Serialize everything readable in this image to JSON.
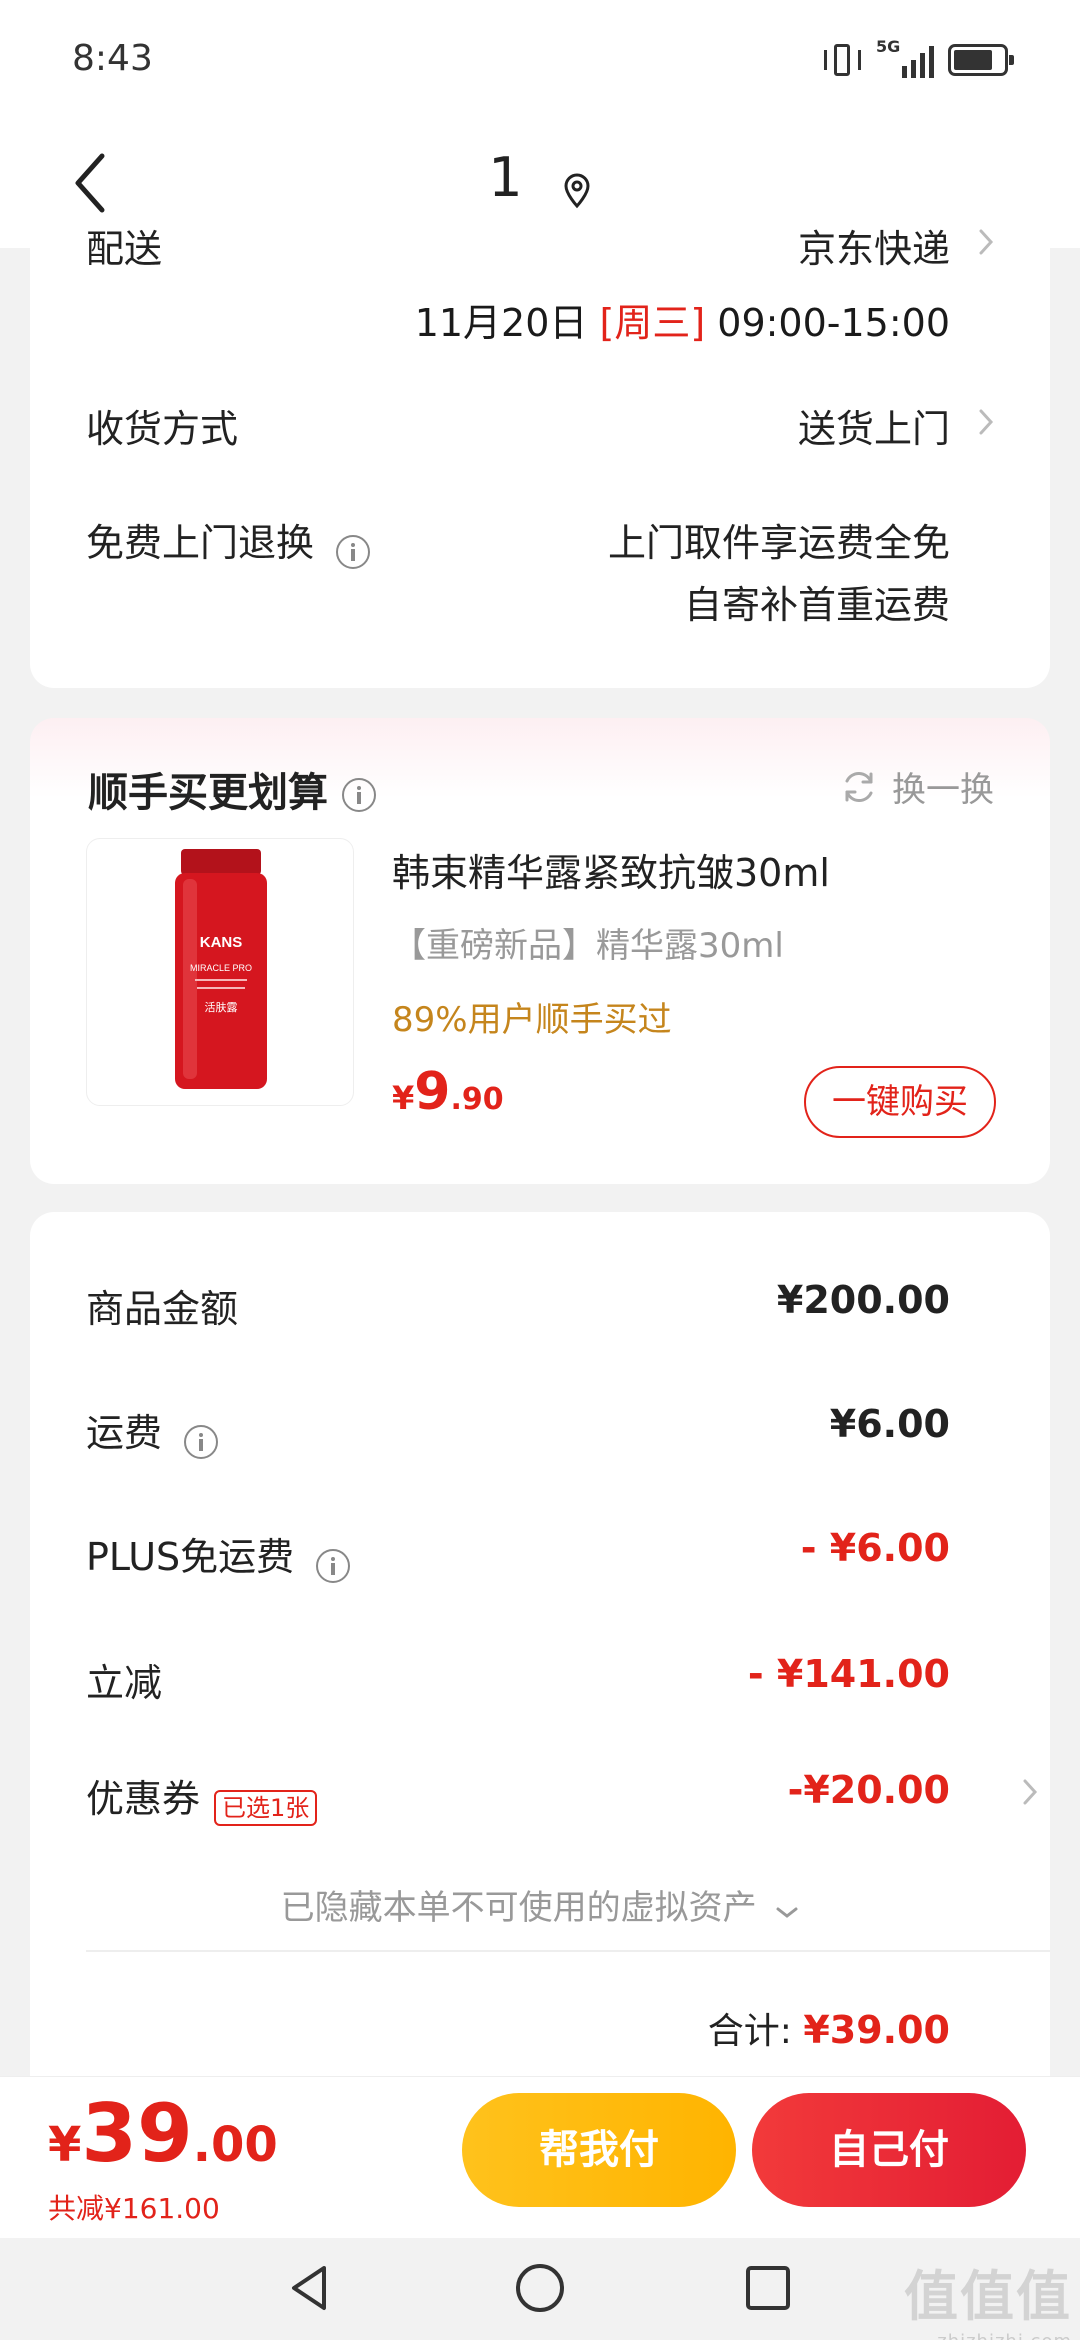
{
  "status_bar": {
    "time": "8:43",
    "network": "5G"
  },
  "header": {
    "title": "1"
  },
  "delivery": {
    "label": "配送",
    "carrier": "京东快递",
    "date": "11月20日",
    "weekday": "[周三]",
    "time_window": "09:00-15:00",
    "receive_label": "收货方式",
    "receive_value": "送货上门",
    "return_label": "免费上门退换",
    "return_line1": "上门取件享运费全免",
    "return_line2": "自寄补首重运费"
  },
  "addon": {
    "title": "顺手买更划算",
    "swap_label": "换一换",
    "product_name": "韩束精华露紧致抗皱30ml",
    "product_tag": "【重磅新品】精华露30ml",
    "product_popularity": "89%用户顺手买过",
    "price_currency": "¥",
    "price_int": "9",
    "price_dec": ".90",
    "buy_label": "一键购买",
    "bottle_brand": "KANS",
    "bottle_line": "MIRACLE PRO",
    "bottle_cn": "活肤露"
  },
  "summary": {
    "goods_label": "商品金额",
    "goods_amount": "¥200.00",
    "freight_label": "运费",
    "freight_amount": "¥6.00",
    "plus_label": "PLUS免运费",
    "plus_amount": "- ¥6.00",
    "discount_label": "立减",
    "discount_amount": "- ¥141.00",
    "coupon_label": "优惠券",
    "coupon_tag": "已选1张",
    "coupon_amount": "-¥20.00",
    "hidden_assets": "已隐藏本单不可使用的虚拟资产",
    "total_label": "合计:",
    "total_amount": "¥39.00"
  },
  "bottom_bar": {
    "currency": "¥",
    "price_int": "39",
    "price_dec": ".00",
    "saved": "共减¥161.00",
    "help_pay": "帮我付",
    "self_pay": "自己付"
  },
  "watermark": {
    "big": "值值值",
    "small": "zhizhizhi.com"
  },
  "colors": {
    "accent_red": "#e2231a",
    "help_yellow": "#ffbb12",
    "gold_text": "#c5851c"
  }
}
